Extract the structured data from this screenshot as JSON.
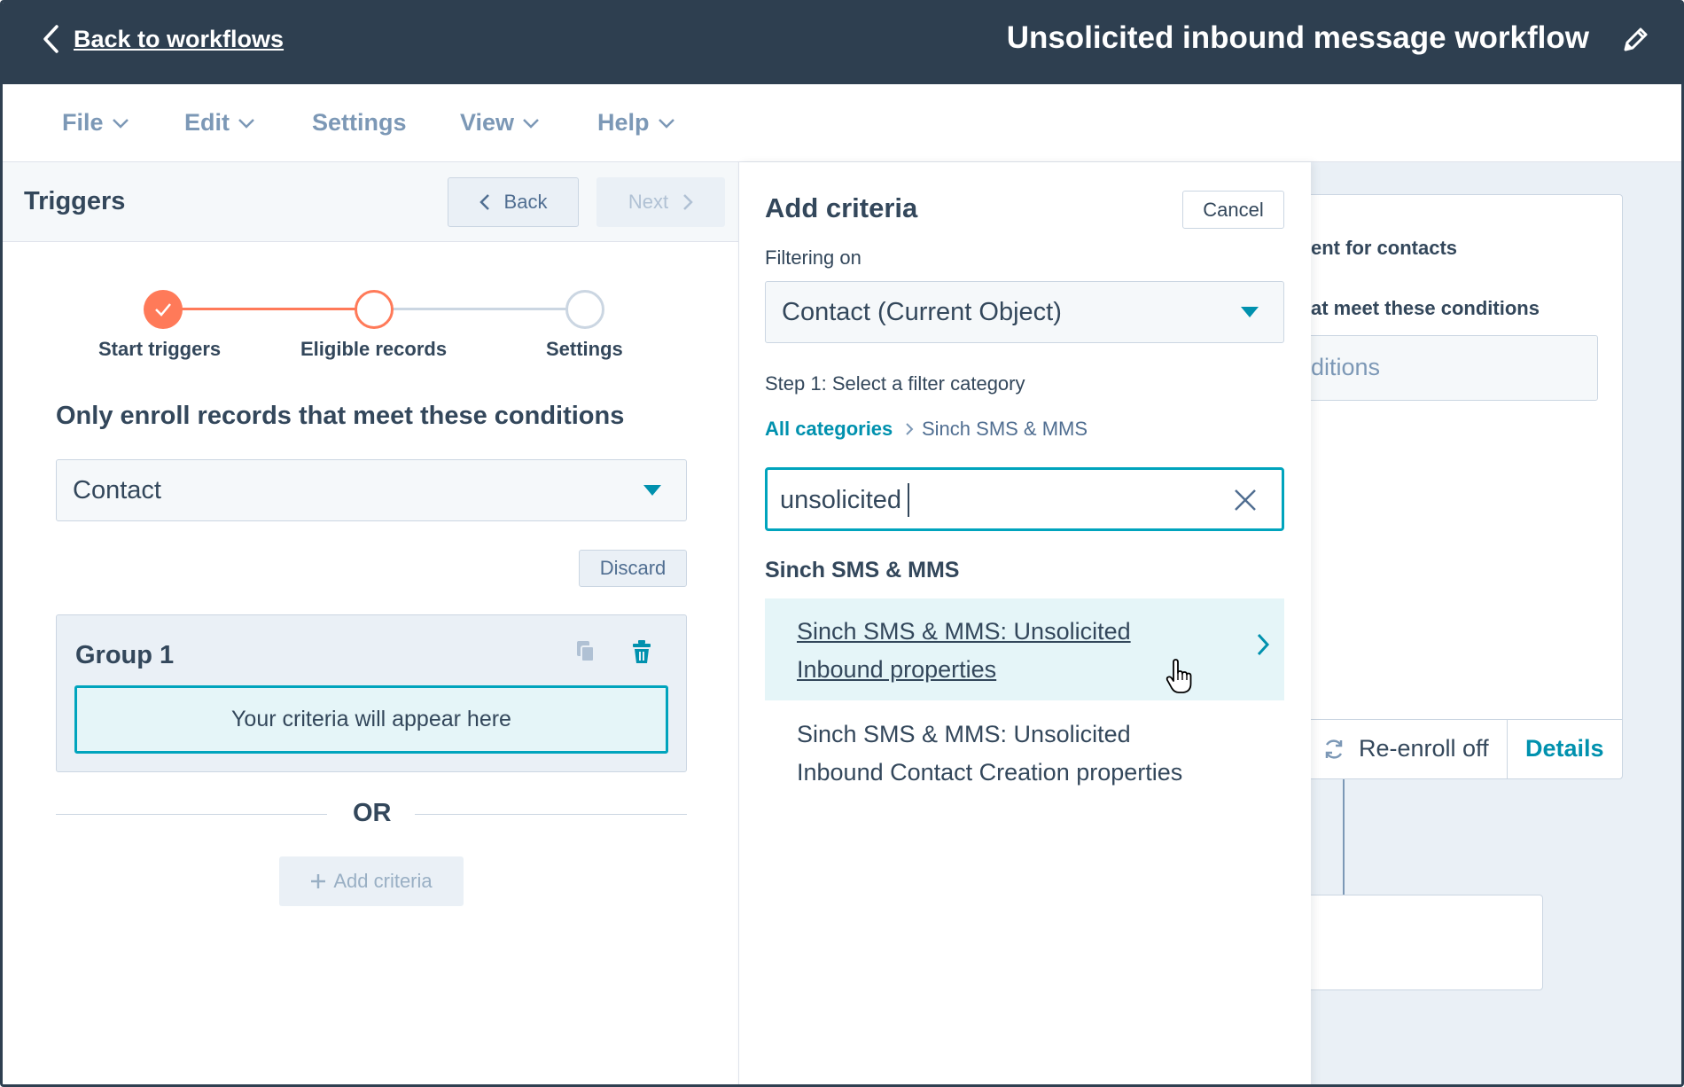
{
  "header": {
    "back_label": "Back to workflows",
    "title": "Unsolicited inbound message workflow"
  },
  "menu": {
    "file": "File",
    "edit": "Edit",
    "settings": "Settings",
    "view": "View",
    "help": "Help"
  },
  "left_panel": {
    "title": "Triggers",
    "back_button": "Back",
    "next_button": "Next",
    "steps": [
      "Start triggers",
      "Eligible records",
      "Settings"
    ],
    "enroll_heading": "Only enroll records that meet these conditions",
    "object_select": "Contact",
    "discard_button": "Discard",
    "group_title": "Group 1",
    "criteria_placeholder": "Your criteria will appear here",
    "or_label": "OR",
    "add_criteria_button": "Add criteria"
  },
  "criteria_panel": {
    "title": "Add criteria",
    "cancel_button": "Cancel",
    "filtering_label": "Filtering on",
    "object_select": "Contact (Current Object)",
    "step_label": "Step 1: Select a filter category",
    "breadcrumb_root": "All categories",
    "breadcrumb_current": "Sinch SMS & MMS",
    "search_value": "unsolicited",
    "section_heading": "Sinch SMS & MMS",
    "results": [
      "Sinch SMS & MMS: Unsolicited Inbound properties",
      "Sinch SMS & MMS: Unsolicited Inbound Contact Creation properties"
    ]
  },
  "canvas": {
    "card_line1": "ent for contacts",
    "card_line2": "at meet these conditions",
    "card_input_text": "ditions",
    "reenroll_label": "Re-enroll off",
    "details_link": "Details"
  },
  "colors": {
    "header_bg": "#2e3f50",
    "accent_teal": "#00a4bd",
    "link_teal": "#0091ae",
    "step_orange": "#ff7a59",
    "canvas_bg": "#eaf0f6"
  },
  "icons": [
    "chevron-left-icon",
    "pencil-icon",
    "chevron-down-icon",
    "check-icon",
    "copy-icon",
    "trash-icon",
    "plus-icon",
    "caret-down-icon",
    "chevron-right-icon",
    "close-icon",
    "refresh-icon",
    "pointer-cursor-icon"
  ]
}
